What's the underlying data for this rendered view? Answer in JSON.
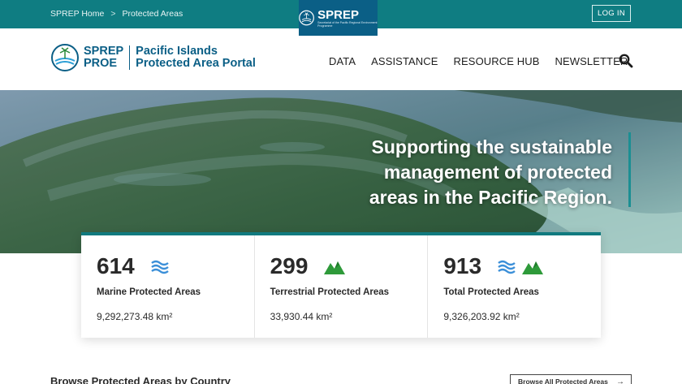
{
  "topbar": {
    "breadcrumb": [
      "SPREP Home",
      "Protected Areas"
    ],
    "breadcrumb_separator": ">",
    "login_label": "LOG IN",
    "badge": {
      "name": "SPREP",
      "subtitle": "Secretariat of the Pacific Regional Environment Programme"
    }
  },
  "header": {
    "logo_mark_line1": "SPREP",
    "logo_mark_line2": "PROE",
    "logo_title_line1": "Pacific Islands",
    "logo_title_line2": "Protected Area Portal",
    "nav": [
      "DATA",
      "ASSISTANCE",
      "RESOURCE HUB",
      "NEWSLETTER"
    ],
    "search_icon": "search-icon"
  },
  "hero": {
    "lines": [
      "Supporting the sustainable",
      "management of protected",
      "areas in the Pacific Region."
    ]
  },
  "stats": [
    {
      "count": "614",
      "label": "Marine Protected Areas",
      "area": "9,292,273.48 km²",
      "icons": [
        "waves-icon"
      ]
    },
    {
      "count": "299",
      "label": "Terrestrial Protected Areas",
      "area": "33,930.44 km²",
      "icons": [
        "mountain-icon"
      ]
    },
    {
      "count": "913",
      "label": "Total Protected Areas",
      "area": "9,326,203.92 km²",
      "icons": [
        "waves-icon",
        "mountain-icon"
      ]
    }
  ],
  "browse": {
    "title": "Browse Protected Areas by Country",
    "button_label": "Browse All Protected Areas",
    "button_arrow": "→"
  },
  "colors": {
    "topbar": "#0f7d82",
    "badge": "#0b5f86",
    "accent": "#117a7f",
    "waves": "#3b8fd8",
    "mountain": "#2e9a3a"
  }
}
